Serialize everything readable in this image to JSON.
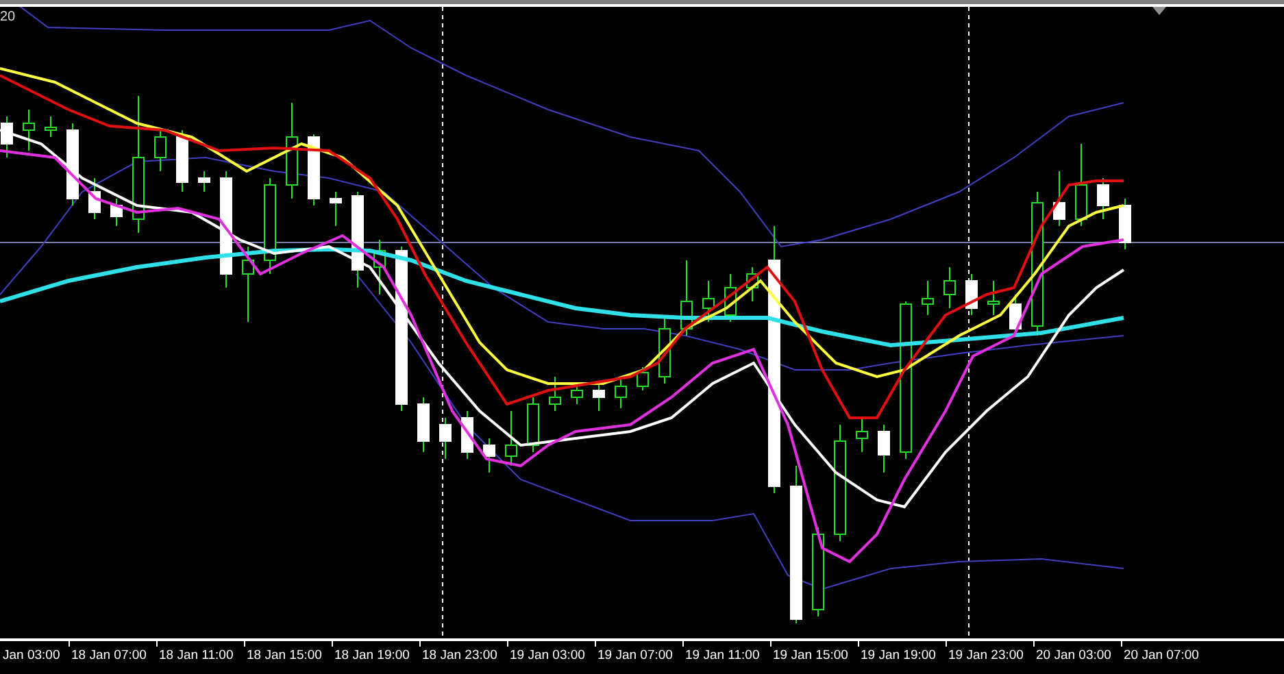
{
  "chart": {
    "corner_label": "20"
  },
  "time_axis": {
    "labels": [
      "Jan 03:00",
      "18 Jan 07:00",
      "18 Jan 11:00",
      "18 Jan 15:00",
      "18 Jan 19:00",
      "18 Jan 23:00",
      "19 Jan 03:00",
      "19 Jan 07:00",
      "19 Jan 11:00",
      "19 Jan 15:00",
      "19 Jan 19:00",
      "19 Jan 23:00",
      "20 Jan 03:00",
      "20 Jan 07:00"
    ]
  }
}
